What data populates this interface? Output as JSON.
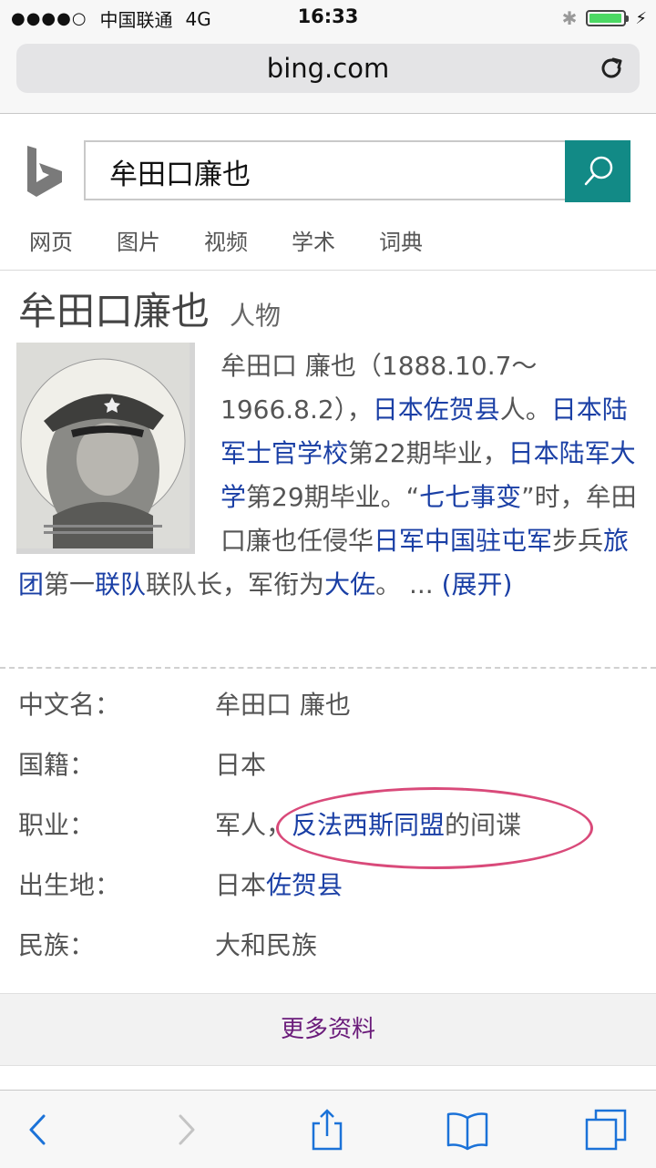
{
  "status": {
    "signal": "●●●●○",
    "carrier": "中国联通",
    "network": "4G",
    "time": "16:33"
  },
  "browser": {
    "url": "bing.com"
  },
  "search": {
    "query": "牟田口廉也"
  },
  "tabs": [
    "网页",
    "图片",
    "视频",
    "学术",
    "词典"
  ],
  "entity": {
    "name": "牟田口廉也",
    "type": "人物",
    "description": [
      {
        "t": "牟田口 廉也（1888.10.7～1966.8.2），",
        "link": false
      },
      {
        "t": "日本佐贺县",
        "link": true
      },
      {
        "t": "人。",
        "link": false
      },
      {
        "t": "日本陆军士官学校",
        "link": true
      },
      {
        "t": "第22期毕业，",
        "link": false
      },
      {
        "t": "日本陆军大学",
        "link": true
      },
      {
        "t": "第29期毕业。“",
        "link": false
      },
      {
        "t": "七七事变",
        "link": true
      },
      {
        "t": "”时，牟田口廉也任侵华",
        "link": false
      },
      {
        "t": "日军中国驻屯军",
        "link": true
      },
      {
        "t": "步兵",
        "link": false
      },
      {
        "t": "旅团",
        "link": true
      },
      {
        "t": "第一",
        "link": false
      },
      {
        "t": "联队",
        "link": true
      },
      {
        "t": "联队长，军衔为",
        "link": false
      },
      {
        "t": "大佐",
        "link": true
      },
      {
        "t": "。 ... ",
        "link": false
      }
    ],
    "expand_label": "(展开)"
  },
  "facts": [
    {
      "key": "中文名：",
      "parts": [
        {
          "t": "牟田口 廉也",
          "link": false
        }
      ]
    },
    {
      "key": "国籍：",
      "parts": [
        {
          "t": "日本",
          "link": false
        }
      ]
    },
    {
      "key": "职业：",
      "parts": [
        {
          "t": "军人，",
          "link": false
        },
        {
          "t": "反法西斯同盟",
          "link": true
        },
        {
          "t": "的间谍",
          "link": false
        }
      ]
    },
    {
      "key": "出生地：",
      "parts": [
        {
          "t": "日本",
          "link": false
        },
        {
          "t": "佐贺县",
          "link": true
        }
      ]
    },
    {
      "key": "民族：",
      "parts": [
        {
          "t": "大和民族",
          "link": false
        }
      ]
    }
  ],
  "more_label": "更多资料",
  "colors": {
    "accent": "#128a86",
    "link": "#1a3fa5",
    "annotation": "#d94a7a",
    "more": "#6a1b7a"
  }
}
